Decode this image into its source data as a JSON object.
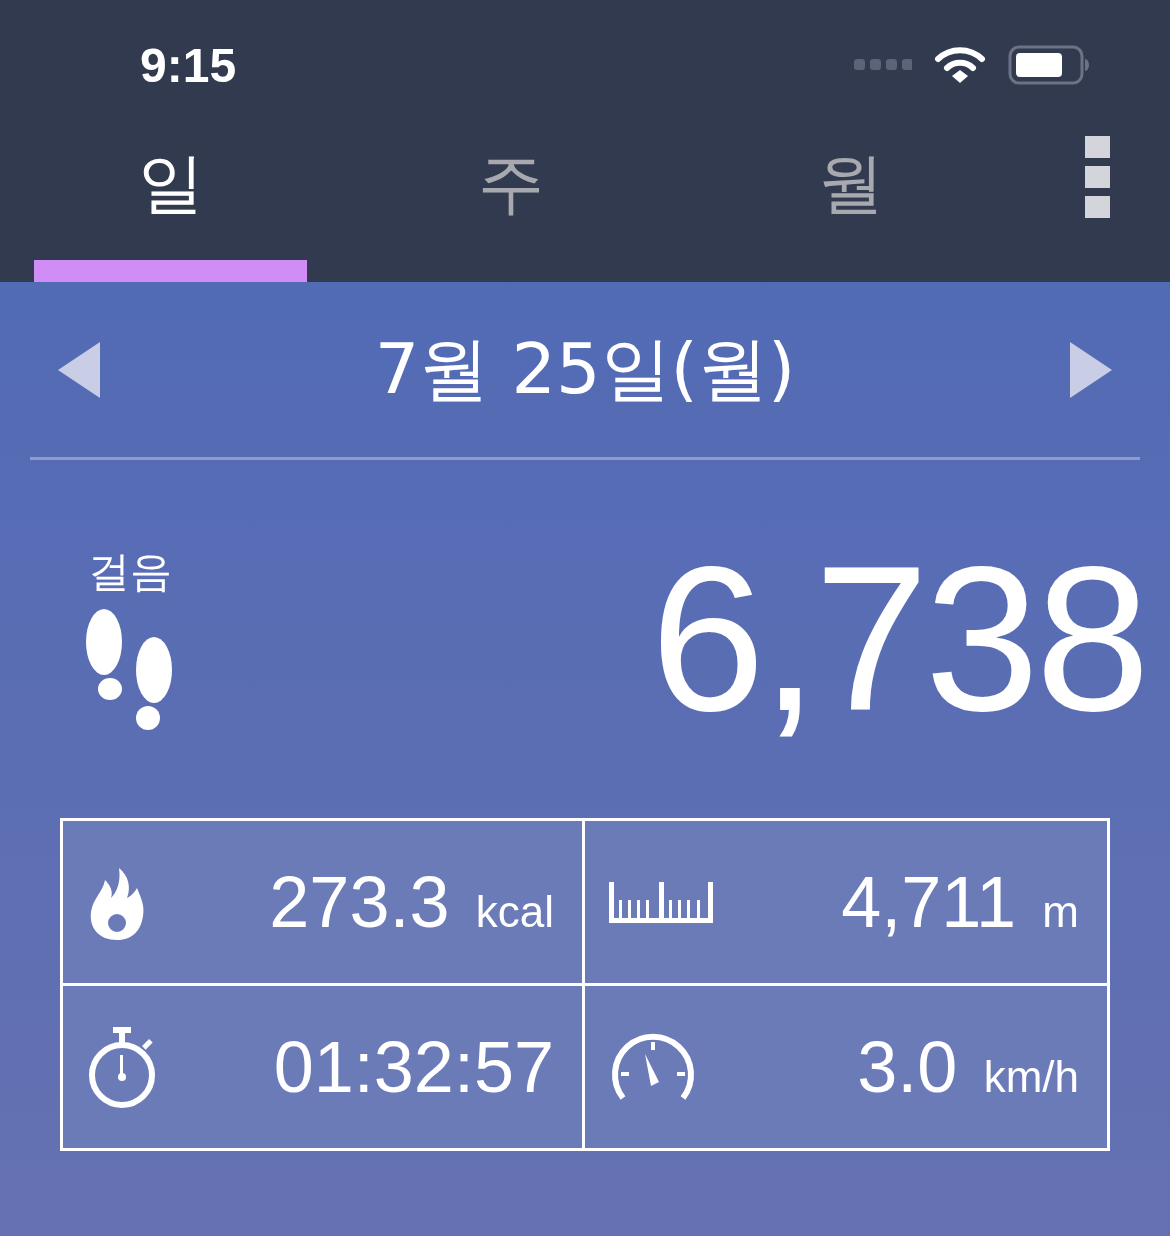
{
  "status_bar": {
    "time": "9:15"
  },
  "tabs": [
    {
      "label": "일",
      "selected": true
    },
    {
      "label": "주",
      "selected": false
    },
    {
      "label": "월",
      "selected": false
    }
  ],
  "date": "7월 25일(월)",
  "steps": {
    "label": "걸음",
    "value": "6,738"
  },
  "stats": [
    {
      "kind": "calories",
      "value": "273.3",
      "unit": "kcal"
    },
    {
      "kind": "distance",
      "value": "4,711",
      "unit": "m"
    },
    {
      "kind": "time",
      "value": "01:32:57"
    },
    {
      "kind": "speed",
      "value": "3.0",
      "unit": "km/h"
    }
  ]
}
